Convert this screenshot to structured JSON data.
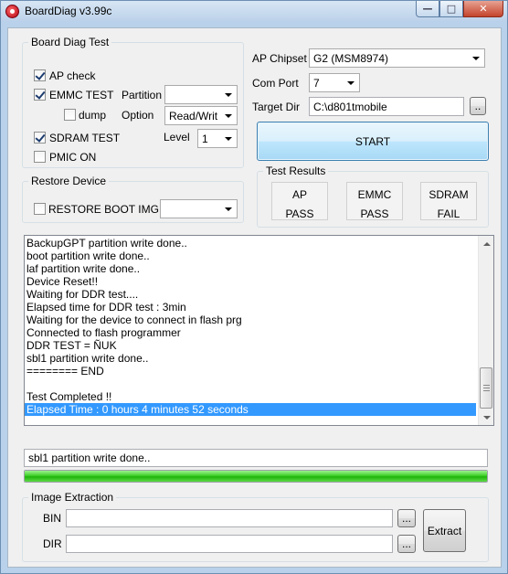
{
  "window": {
    "title": "BoardDiag v3.99c",
    "min_glyph": "—",
    "max_glyph": "□",
    "close_glyph": "✕"
  },
  "board_diag_test": {
    "title": "Board Diag Test",
    "ap_check": {
      "label": "AP check",
      "checked": true
    },
    "emmc_test": {
      "label": "EMMC TEST",
      "checked": true
    },
    "dump": {
      "label": "dump",
      "checked": false
    },
    "sdram_test": {
      "label": "SDRAM TEST",
      "checked": true
    },
    "pmic_on": {
      "label": "PMIC ON",
      "checked": false
    },
    "partition_label": "Partition",
    "partition_value": "",
    "option_label": "Option",
    "option_value": "Read/Writ",
    "level_label": "Level",
    "level_value": "1"
  },
  "restore_device": {
    "title": "Restore Device",
    "restore_boot_img": {
      "label": "RESTORE BOOT IMG",
      "checked": false
    },
    "restore_value": ""
  },
  "config": {
    "ap_chipset_label": "AP Chipset",
    "ap_chipset_value": "G2 (MSM8974)",
    "com_port_label": "Com Port",
    "com_port_value": "7",
    "target_dir_label": "Target Dir",
    "target_dir_value": "C:\\d801tmobile",
    "browse_label": "..",
    "start_label": "START"
  },
  "test_results": {
    "title": "Test Results",
    "items": [
      {
        "name": "AP",
        "result": "PASS"
      },
      {
        "name": "EMMC",
        "result": "PASS"
      },
      {
        "name": "SDRAM",
        "result": "FAIL"
      }
    ]
  },
  "log": {
    "lines": [
      "BackupGPT partition write done..",
      "boot partition write done..",
      "laf partition write done..",
      "Device Reset!!",
      "Waiting for DDR test....",
      "Elapsed time for DDR test : 3min",
      "Waiting for the device to connect in flash prg",
      "Connected to flash programmer",
      "DDR TEST = ÑUK",
      "sbl1 partition write done..",
      "======== END",
      "",
      "Test Completed !!",
      "Elapsed Time : 0 hours 4 minutes 52 seconds"
    ],
    "selected_index": 13
  },
  "status_text": "sbl1 partition write done..",
  "progress": {
    "fraction": 1.0
  },
  "image_extraction": {
    "title": "Image Extraction",
    "bin_label": "BIN",
    "bin_value": "",
    "dir_label": "DIR",
    "dir_value": "",
    "browse_label": "...",
    "extract_label": "Extract"
  }
}
